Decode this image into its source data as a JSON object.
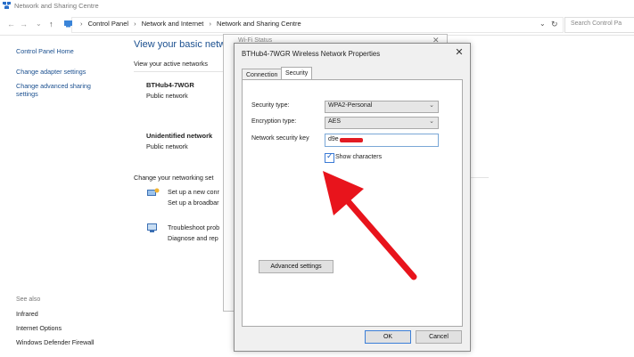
{
  "window": {
    "title": "Network and Sharing Centre"
  },
  "address_bar": {
    "breadcrumbs": [
      "Control Panel",
      "Network and Internet",
      "Network and Sharing Centre"
    ],
    "search_placeholder": "Search Control Pa"
  },
  "sidebar": {
    "items": [
      "Control Panel Home",
      "Change adapter settings",
      "Change advanced sharing",
      "settings"
    ],
    "see_also_label": "See also",
    "see_also": [
      "Infrared",
      "Internet Options",
      "Windows Defender Firewall"
    ]
  },
  "main": {
    "title": "View your basic netw",
    "active_networks_label": "View your active networks",
    "networks": [
      {
        "name": "BTHub4-7WGR",
        "type": "Public network"
      },
      {
        "name": "Unidentified network",
        "type": "Public network"
      }
    ],
    "change_settings_label": "Change your networking set",
    "tasks": [
      {
        "link": "Set up a new conr",
        "desc": "Set up a broadbar"
      },
      {
        "link": "Troubleshoot prob",
        "desc": "Diagnose and rep"
      }
    ]
  },
  "background_window": {
    "title": "Wi-Fi Status"
  },
  "dialog": {
    "title": "BTHub4-7WGR Wireless Network Properties",
    "close_glyph": "✕",
    "tabs": [
      "Connection",
      "Security"
    ],
    "active_tab": "Security",
    "security_type_label": "Security type:",
    "security_type_value": "WPA2-Personal",
    "encryption_type_label": "Encryption type:",
    "encryption_type_value": "AES",
    "key_label": "Network security key",
    "key_value": "d9e",
    "show_characters_label": "Show characters",
    "show_characters_checked": true,
    "advanced_button": "Advanced settings",
    "ok_button": "OK",
    "cancel_button": "Cancel"
  },
  "annotation": {
    "arrow_color": "#e8141c",
    "redaction_color": "#e21b23"
  }
}
